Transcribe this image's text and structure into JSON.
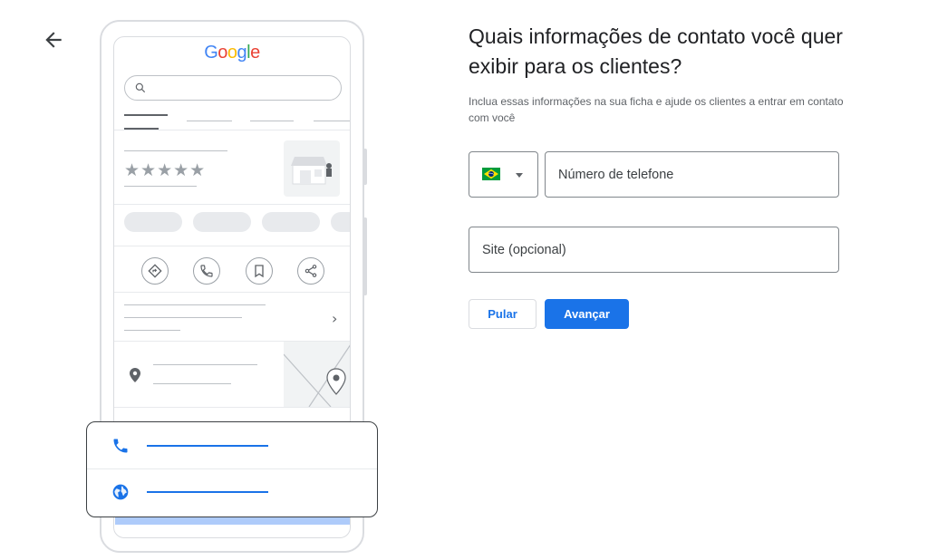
{
  "header": {
    "title": "Quais informações de contato você quer exibir para os clientes?",
    "description": "Inclua essas informações na sua ficha e ajude os clientes a entrar em contato com você"
  },
  "illustration": {
    "logo_text": "Google",
    "rating_stars": "★★★★★",
    "logo_colors": [
      "#4285F4",
      "#EA4335",
      "#FBBC05",
      "#4285F4",
      "#34A853",
      "#EA4335"
    ]
  },
  "form": {
    "country_flag": "brazil-flag-icon",
    "phone_placeholder": "Número de telefone",
    "site_placeholder": "Site (opcional)",
    "skip_label": "Pular",
    "next_label": "Avançar"
  },
  "colors": {
    "accent": "#1a73e8",
    "border": "#80868b"
  }
}
